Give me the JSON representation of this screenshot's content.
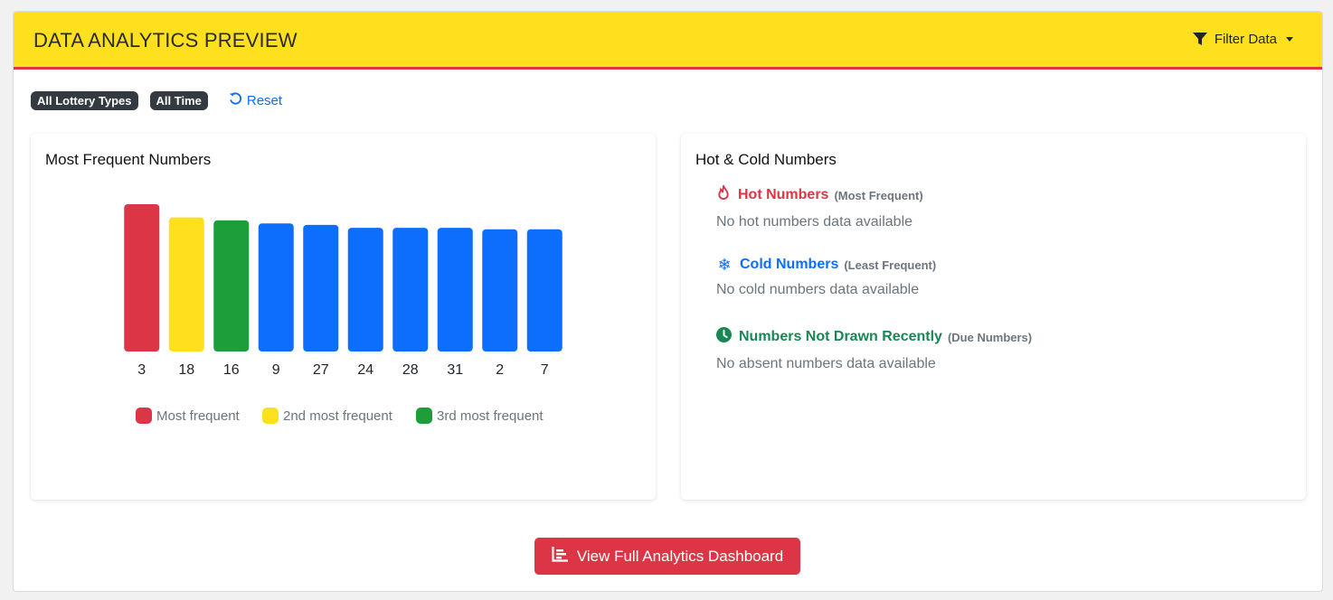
{
  "header": {
    "title": "DATA ANALYTICS PREVIEW",
    "filter_label": "Filter Data"
  },
  "filters": {
    "badges": [
      "All Lottery Types",
      "All Time"
    ],
    "reset_label": "Reset"
  },
  "frequent_panel": {
    "title": "Most Frequent Numbers"
  },
  "hot_cold_panel": {
    "title": "Hot & Cold Numbers",
    "hot": {
      "title": "Hot Numbers",
      "subtitle": "(Most Frequent)",
      "empty": "No hot numbers data available"
    },
    "cold": {
      "title": "Cold Numbers",
      "subtitle": "(Least Frequent)",
      "empty": "No cold numbers data available"
    },
    "due": {
      "title": "Numbers Not Drawn Recently",
      "subtitle": "(Due Numbers)",
      "empty": "No absent numbers data available"
    }
  },
  "colors": {
    "header_bg": "#ffe01f",
    "accent_red": "#dc3545",
    "yellow": "#ffe01f",
    "green": "#1e9e3b",
    "blue": "#0d6efd"
  },
  "icons": {
    "filter": "funnel-icon",
    "reset": "undo-icon",
    "hot": "fire-icon",
    "cold": "snowflake-icon",
    "due": "clock-icon",
    "cta": "bar-chart-icon"
  },
  "chart_data": {
    "type": "bar",
    "categories": [
      "3",
      "18",
      "16",
      "9",
      "27",
      "24",
      "28",
      "31",
      "2",
      "7"
    ],
    "values": [
      100,
      91,
      89,
      87,
      86,
      84,
      84,
      84,
      83,
      83
    ],
    "bar_colors": [
      "#dc3545",
      "#ffe01f",
      "#1e9e3b",
      "#0d6efd",
      "#0d6efd",
      "#0d6efd",
      "#0d6efd",
      "#0d6efd",
      "#0d6efd",
      "#0d6efd"
    ],
    "legend": [
      {
        "label": "Most frequent",
        "color": "#dc3545"
      },
      {
        "label": "2nd most frequent",
        "color": "#ffe01f"
      },
      {
        "label": "3rd most frequent",
        "color": "#1e9e3b"
      }
    ],
    "ylim": [
      0,
      100
    ],
    "legend_position": "bottom",
    "grid": false
  },
  "cta": {
    "label": "View Full Analytics Dashboard"
  }
}
